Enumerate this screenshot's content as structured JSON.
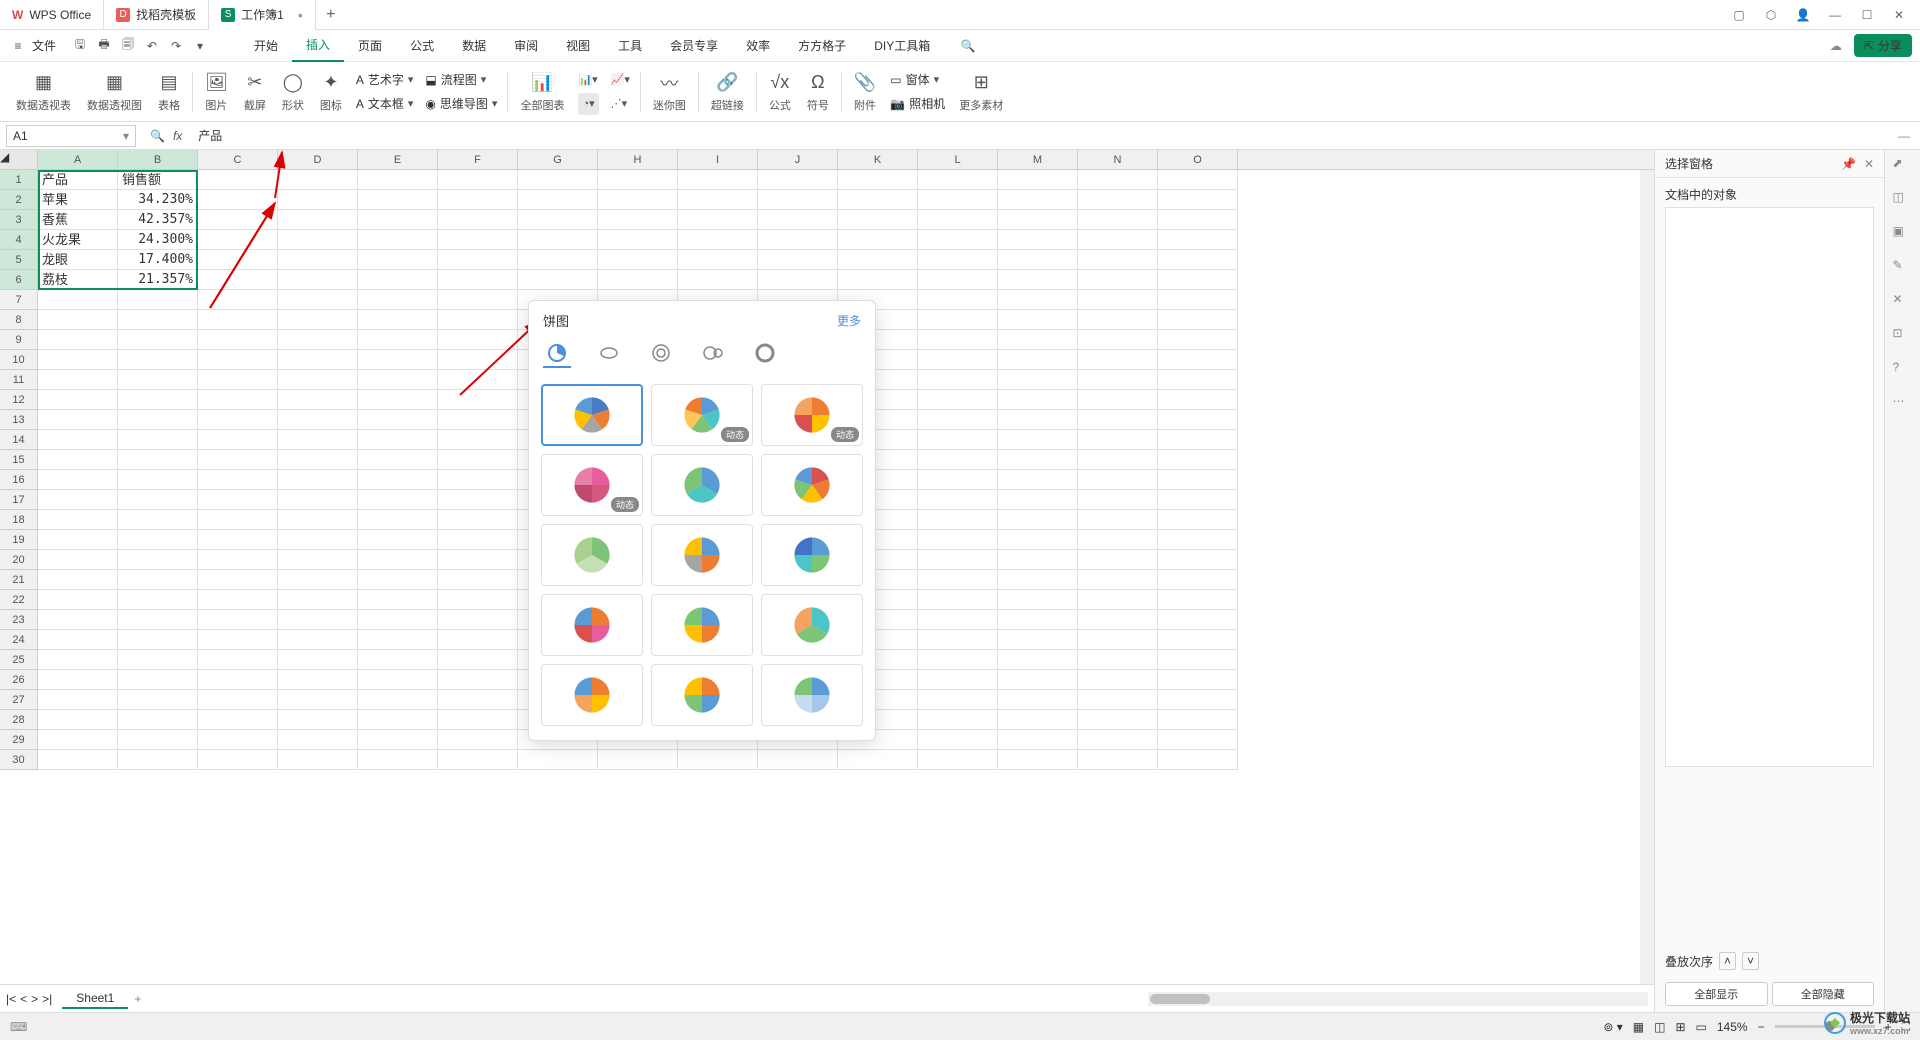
{
  "titlebar": {
    "tabs": [
      {
        "icon": "W",
        "iconColor": "#d14b4b",
        "label": "WPS Office"
      },
      {
        "icon": "D",
        "iconColor": "#e85d5d",
        "label": "找稻壳模板"
      },
      {
        "icon": "S",
        "iconColor": "#0a8f5c",
        "label": "工作簿1",
        "active": true,
        "closable": true
      }
    ]
  },
  "menubar": {
    "file": "文件",
    "tabs": [
      "开始",
      "插入",
      "页面",
      "公式",
      "数据",
      "审阅",
      "视图",
      "工具",
      "会员专享",
      "效率",
      "方方格子",
      "DIY工具箱"
    ],
    "activeIndex": 1,
    "share": "分享"
  },
  "ribbon": {
    "items": [
      {
        "label": "数据透视表"
      },
      {
        "label": "数据透视图"
      },
      {
        "label": "表格"
      },
      {
        "label": "图片"
      },
      {
        "label": "截屏"
      },
      {
        "label": "形状"
      },
      {
        "label": "图标"
      },
      {
        "label": "全部图表"
      },
      {
        "label": "迷你图"
      },
      {
        "label": "超链接"
      },
      {
        "label": "公式"
      },
      {
        "label": "符号"
      },
      {
        "label": "附件"
      },
      {
        "label": "更多素材"
      }
    ],
    "small": {
      "art": "艺术字",
      "flow": "流程图",
      "textbox": "文本框",
      "mindmap": "思维导图",
      "frame": "窗体",
      "camera": "照相机"
    }
  },
  "formula": {
    "cellref": "A1",
    "value": "产品"
  },
  "sheet": {
    "cols": [
      "A",
      "B",
      "C",
      "D",
      "E",
      "F",
      "G",
      "H",
      "I",
      "J",
      "K",
      "L",
      "M",
      "N",
      "O"
    ],
    "rowcount": 30,
    "data": [
      [
        "产品",
        "销售额"
      ],
      [
        "苹果",
        "34.230%"
      ],
      [
        "香蕉",
        "42.357%"
      ],
      [
        "火龙果",
        "24.300%"
      ],
      [
        "龙眼",
        "17.400%"
      ],
      [
        "荔枝",
        "21.357%"
      ]
    ]
  },
  "chart_data": {
    "type": "pie",
    "title": "销售额",
    "categories": [
      "苹果",
      "香蕉",
      "火龙果",
      "龙眼",
      "荔枝"
    ],
    "values": [
      34.23,
      42.357,
      24.3,
      17.4,
      21.357
    ]
  },
  "popup": {
    "title": "饼图",
    "more": "更多",
    "badge": "动态",
    "templates": [
      {
        "selected": true
      },
      {
        "badge": true
      },
      {
        "badge": true
      },
      {
        "badge": true
      },
      {},
      {},
      {},
      {},
      {},
      {},
      {},
      {},
      {},
      {},
      {}
    ]
  },
  "rightpanel": {
    "title": "选择窗格",
    "subtitle": "文档中的对象",
    "stack": "叠放次序",
    "showAll": "全部显示",
    "hideAll": "全部隐藏"
  },
  "sheettabs": {
    "active": "Sheet1"
  },
  "statusbar": {
    "zoom": "145%"
  },
  "watermark": {
    "brand": "极光下载站",
    "url": "www.xz7.com"
  }
}
